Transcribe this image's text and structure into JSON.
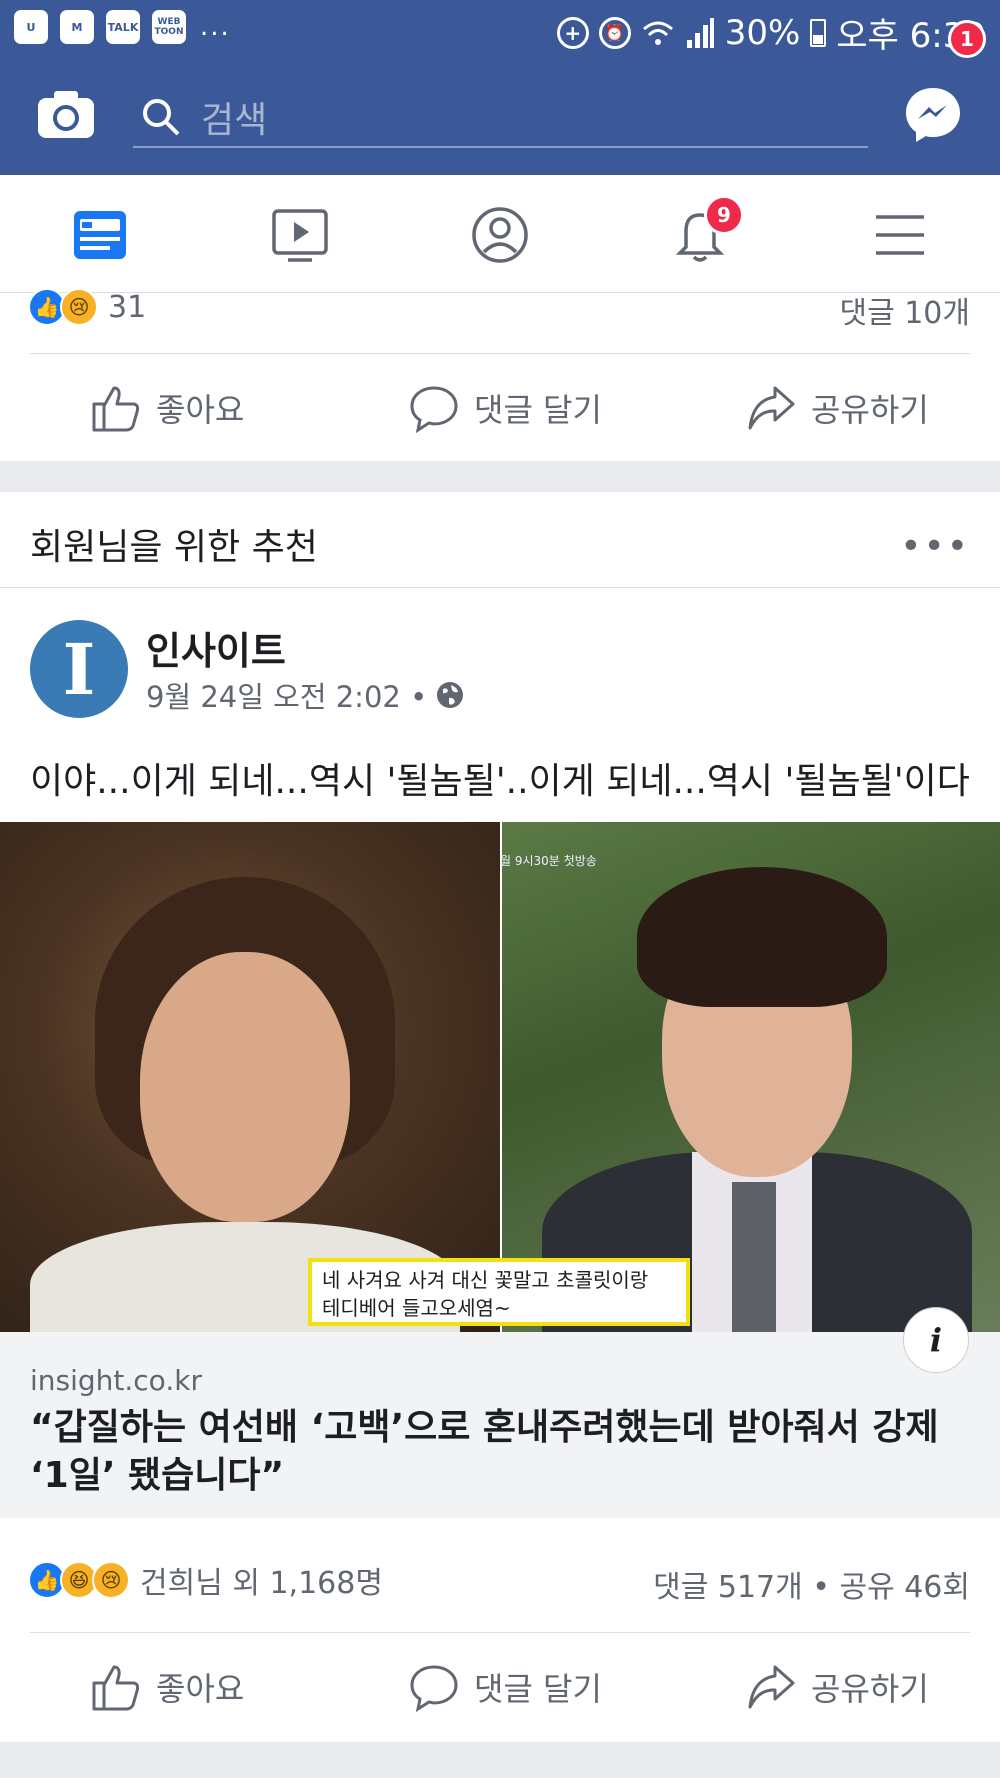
{
  "status_bar": {
    "app_icons": [
      "u-app-icon",
      "gmail-icon",
      "kakaotalk-icon",
      "webtoon-icon"
    ],
    "talk_label": "TALK",
    "webtoon_label": "WEB TOON",
    "more": "...",
    "battery": "30%",
    "time": "오후 6:39"
  },
  "header": {
    "search_placeholder": "검색",
    "messenger_badge": "1"
  },
  "tabs": [
    "news-feed",
    "watch",
    "profile",
    "notifications",
    "menu"
  ],
  "notifications_badge": "9",
  "top_post": {
    "reaction_count": "31",
    "comments": "댓글 10개"
  },
  "actions": {
    "like": "좋아요",
    "comment": "댓글 달기",
    "share": "공유하기"
  },
  "recommendation": {
    "title": "회원님을 위한 추천",
    "more": "•••",
    "page_name": "인사이트",
    "avatar_letter": "I",
    "post_time": "9월 24일 오전 2:02 •",
    "post_text": "이야...이게 되네...역시 '될놈될'..이게 되네...역시 '될놈될'이다",
    "photo_small_text": "월 9시30분 첫방송",
    "subtitle_line1": "네 사겨요 사겨 대신 꽃말고 초콜릿이랑",
    "subtitle_line2": "테디베어 들고오세염~",
    "info": "i",
    "link_domain": "insight.co.kr",
    "link_title": "“갑질하는 여선배 ‘고백’으로 혼내주려했는데 받아줘서 강제 ‘1일’ 됐습니다”",
    "reactions_text": "건희님 외 1,168명",
    "stats": "댓글 517개 • 공유 46회"
  },
  "colors": {
    "facebook_blue": "#3b5998",
    "like_blue": "#1877f2",
    "badge_red": "#f02849",
    "subtitle_border": "#f0e10f"
  }
}
